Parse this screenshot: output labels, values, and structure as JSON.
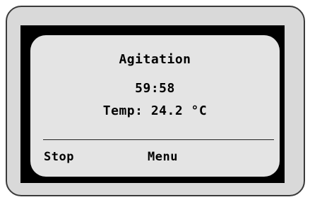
{
  "screen": {
    "mode_title": "Agitation",
    "timer": "59:58",
    "temperature": "Temp: 24.2 °C"
  },
  "softkeys": {
    "left_label": "Stop",
    "middle_label": "Menu"
  },
  "colors": {
    "device_body": "#d9d9d9",
    "bezel": "#000000",
    "screen_background": "#e4e4e4",
    "text": "#000000"
  }
}
